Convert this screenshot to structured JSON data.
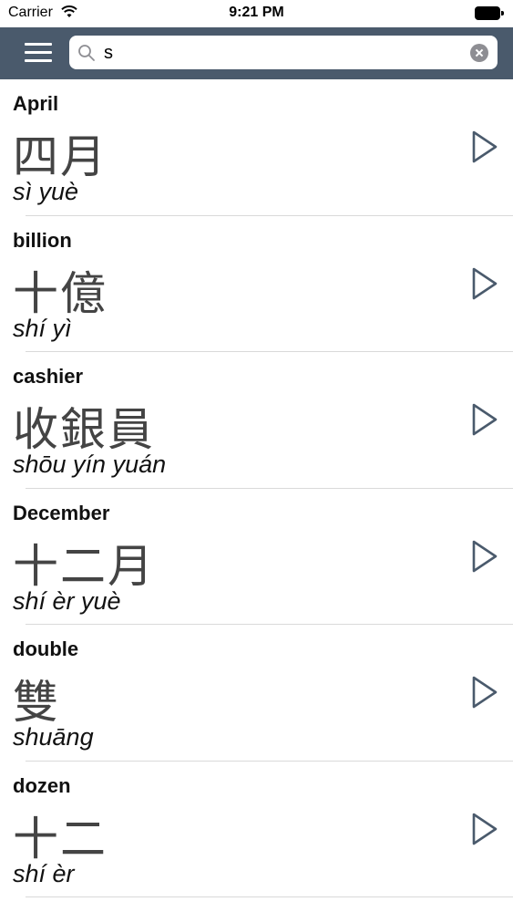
{
  "status_bar": {
    "carrier": "Carrier",
    "time": "9:21 PM"
  },
  "nav_bar": {
    "background": "#4a5a6c",
    "menu_icon": "hamburger-icon",
    "search": {
      "value": "s",
      "icon": "search-icon",
      "clear_icon": "clear-icon"
    }
  },
  "words": [
    {
      "english": "April",
      "hanzi": "四月",
      "pinyin": "sì yuè"
    },
    {
      "english": "billion",
      "hanzi": "十億",
      "pinyin": "shí yì"
    },
    {
      "english": "cashier",
      "hanzi": "收銀員",
      "pinyin": "shōu yín yuán"
    },
    {
      "english": "December",
      "hanzi": "十二月",
      "pinyin": "shí èr yuè"
    },
    {
      "english": "double",
      "hanzi": "雙",
      "pinyin": "shuāng"
    },
    {
      "english": "dozen",
      "hanzi": "十二",
      "pinyin": "shí èr"
    }
  ],
  "play_icon": "play-icon"
}
